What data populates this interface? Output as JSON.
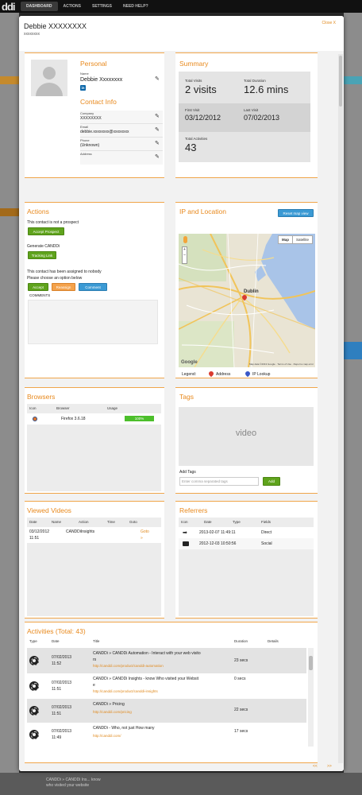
{
  "app": {
    "logo": "ddi",
    "nav": [
      "DASHBOARD",
      "ACTIONS",
      "SETTINGS",
      "NEED HELP?"
    ]
  },
  "modal": {
    "title": "Debbie XXXXXXXX",
    "subtitle": "xxxxxxxx",
    "close_label": "Close X"
  },
  "personal": {
    "title": "Personal",
    "name_label": "Name",
    "name": "Debbie Xxxxxxxx",
    "linkedin_icon": "in",
    "contact_title": "Contact Info",
    "company_label": "Company",
    "company": "XXXXXXXX",
    "email_label": "Email",
    "email": "debbie.xxxxxxxx@xxxxxxxx",
    "phone_label": "Phone",
    "phone": "(Unknown)",
    "address_label": "Address"
  },
  "summary": {
    "title": "Summary",
    "total_visits_label": "Total Visits",
    "total_visits": "2 visits",
    "total_duration_label": "Total Duration",
    "total_duration": "12.6 mins",
    "first_visit_label": "First Visit",
    "first_visit": "03/12/2012",
    "last_visit_label": "Last Visit",
    "last_visit": "07/02/2013",
    "total_activities_label": "Total Activities",
    "total_activities": "43"
  },
  "actions": {
    "title": "Actions",
    "prospect_text": "This contact is not a prospect",
    "accept_prospect": "Accept Prospect",
    "generate_text": "Generate CANDDi",
    "tracking_link": "Tracking Link",
    "assigned_text": "This contact has been assigned to nobody",
    "choose_text": "Please choose an option below",
    "accept": "Accept",
    "reassign": "Reassign",
    "comment": "Comment",
    "comments_label": "COMMENTS"
  },
  "ip": {
    "title": "IP and Location",
    "reset_map": "Reset map view",
    "map_tab": "Map",
    "satellite_tab": "Satellite",
    "city": "Dublin",
    "google": "Google",
    "map_footer": "Map data ©2013 Google · Terms of Use · Report a map error",
    "legend_label": "Legend:",
    "legend_address": "Address",
    "legend_ip": "IP Lookup"
  },
  "browsers": {
    "title": "Browsers",
    "columns": [
      "Icon",
      "Browser",
      "Usage"
    ],
    "rows": [
      {
        "browser": "Firefox 3.6.18",
        "usage": "100%",
        "usage_fraction": 1.0
      }
    ]
  },
  "tags": {
    "title": "Tags",
    "video_placeholder": "video",
    "add_tags_label": "Add Tags",
    "input_placeholder": "Enter comma separated tags",
    "add_button": "Add"
  },
  "videos": {
    "title": "Viewed Videos",
    "columns": [
      "Date",
      "Name",
      "Action",
      "Time",
      "Goto"
    ],
    "rows": [
      {
        "date": "03/12/2012",
        "time_line": "11:51",
        "name": "CANDDiInsights",
        "goto": "Goto",
        "goto_arrow": "»"
      }
    ]
  },
  "referrers": {
    "title": "Referrers",
    "columns": [
      "Icon",
      "Date",
      "Type",
      "Fields"
    ],
    "rows": [
      {
        "date": "2013-02-07 11:49:11",
        "fields": "Direct"
      },
      {
        "date": "2012-12-03 10:50:56",
        "fields": "Social"
      }
    ]
  },
  "activities": {
    "title": "Activities (Total: 43)",
    "columns": [
      "Type",
      "Date",
      "Title",
      "Duration",
      "Details"
    ],
    "rows": [
      {
        "date": "07/02/2013",
        "time": "11:52",
        "title": "CANDDi » CANDDi Automation - Interact with your web visito",
        "title2": "rs",
        "url": "http://canddi.com/product/canddi-automation",
        "duration": "23 secs"
      },
      {
        "date": "07/02/2013",
        "time": "11:51",
        "title": "CANDDi » CANDDi Insights - know Who visited your Websit",
        "title2": "e",
        "url": "http://canddi.com/product/canddi-insights",
        "duration": "0 secs"
      },
      {
        "date": "07/02/2013",
        "time": "11:51",
        "title": "CANDDi » Pricing",
        "title2": "",
        "url": "http://canddi.com/pricing",
        "duration": "22 secs"
      },
      {
        "date": "07/02/2013",
        "time": "11:49",
        "title": "CANDDi - Who, not just How many",
        "title2": "",
        "url": "http://canddi.com/",
        "duration": "17 secs"
      }
    ]
  },
  "pager": {
    "prev": "<<",
    "next": ">>"
  },
  "background": {
    "bottom_text": "CANDDi » CANDDi Ins... know who visited your website"
  }
}
